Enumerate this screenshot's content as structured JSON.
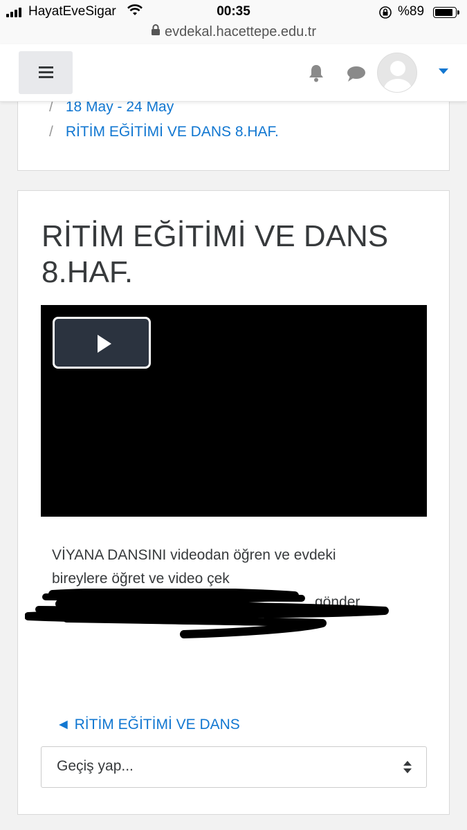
{
  "status_bar": {
    "carrier": "HayatEveSigar",
    "time": "00:35",
    "battery": "%89",
    "battery_level": 0.89
  },
  "url_bar": {
    "url": "evdekal.hacettepe.edu.tr"
  },
  "navbar": {
    "menu_icon": "hamburger-icon",
    "notifications_icon": "bell-icon",
    "messages_icon": "chat-icon",
    "user_icon": "avatar",
    "dropdown_icon": "caret-down-icon",
    "accent_color": "#1177d1"
  },
  "breadcrumb": {
    "separator": "/",
    "items": [
      "18 May - 24 May",
      "RİTİM EĞİTİMİ VE DANS 8.HAF."
    ]
  },
  "main": {
    "title": "RİTİM EĞİTİMİ VE DANS 8.HAF.",
    "video": {
      "play_icon": "play-icon"
    },
    "description_line1": "VİYANA DANSINI videodan öğren ve evdeki",
    "description_line2": "bireylere öğret ve video çek",
    "description_line3_visible": "gönder",
    "prev_activity_link": "◄ RİTİM EĞİTİMİ VE DANS",
    "jump_select": {
      "selected": "Geçiş yap..."
    }
  }
}
